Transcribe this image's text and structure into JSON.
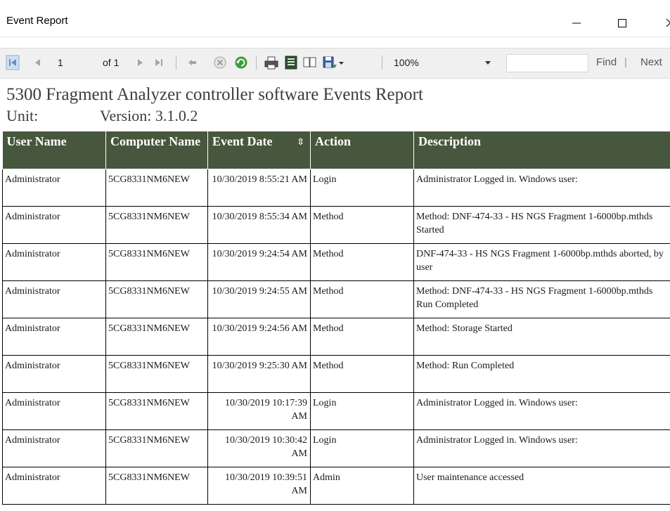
{
  "window": {
    "title": "Event Report"
  },
  "toolbar": {
    "page_value": "1",
    "page_of": "of 1",
    "zoom": "100%",
    "find_label": "Find",
    "find_sep": "|",
    "next_label": "Next",
    "icons": [
      "first-page-icon",
      "previous-page-icon",
      "next-page-icon",
      "last-page-icon",
      "back-icon",
      "stop-icon",
      "refresh-icon",
      "print-icon",
      "print-layout-icon",
      "page-setup-icon",
      "save-icon"
    ]
  },
  "report": {
    "title": "5300 Fragment Analyzer controller software Events Report",
    "unit_label": "Unit:",
    "version_label": "Version: 3.1.0.2",
    "header_color": "#47573d",
    "columns": [
      "User Name",
      "Computer Name",
      "Event Date",
      "Action",
      "Description"
    ],
    "rows": [
      {
        "user": "Administrator",
        "computer": "5CG8331NM6NEW",
        "date": "10/30/2019 8:55:21 AM",
        "action": "Login",
        "description": "Administrator Logged in. Windows user:"
      },
      {
        "user": "Administrator",
        "computer": "5CG8331NM6NEW",
        "date": "10/30/2019 8:55:34 AM",
        "action": "Method",
        "description": "Method: DNF-474-33 - HS NGS Fragment 1-6000bp.mthds Started"
      },
      {
        "user": "Administrator",
        "computer": "5CG8331NM6NEW",
        "date": "10/30/2019 9:24:54 AM",
        "action": "Method",
        "description": "DNF-474-33 - HS NGS Fragment 1-6000bp.mthds aborted, by user"
      },
      {
        "user": "Administrator",
        "computer": "5CG8331NM6NEW",
        "date": "10/30/2019 9:24:55 AM",
        "action": "Method",
        "description": "Method: DNF-474-33 - HS NGS Fragment 1-6000bp.mthds Run Completed"
      },
      {
        "user": "Administrator",
        "computer": "5CG8331NM6NEW",
        "date": "10/30/2019 9:24:56 AM",
        "action": "Method",
        "description": "Method: Storage Started"
      },
      {
        "user": "Administrator",
        "computer": "5CG8331NM6NEW",
        "date": "10/30/2019 9:25:30 AM",
        "action": "Method",
        "description": "Method: Run Completed"
      },
      {
        "user": "Administrator",
        "computer": "5CG8331NM6NEW",
        "date": "10/30/2019 10:17:39 AM",
        "action": "Login",
        "description": "Administrator Logged in. Windows user:"
      },
      {
        "user": "Administrator",
        "computer": "5CG8331NM6NEW",
        "date": "10/30/2019 10:30:42 AM",
        "action": "Login",
        "description": "Administrator Logged in. Windows user:"
      },
      {
        "user": "Administrator",
        "computer": "5CG8331NM6NEW",
        "date": "10/30/2019 10:39:51 AM",
        "action": "Admin",
        "description": "User maintenance accessed"
      }
    ]
  }
}
